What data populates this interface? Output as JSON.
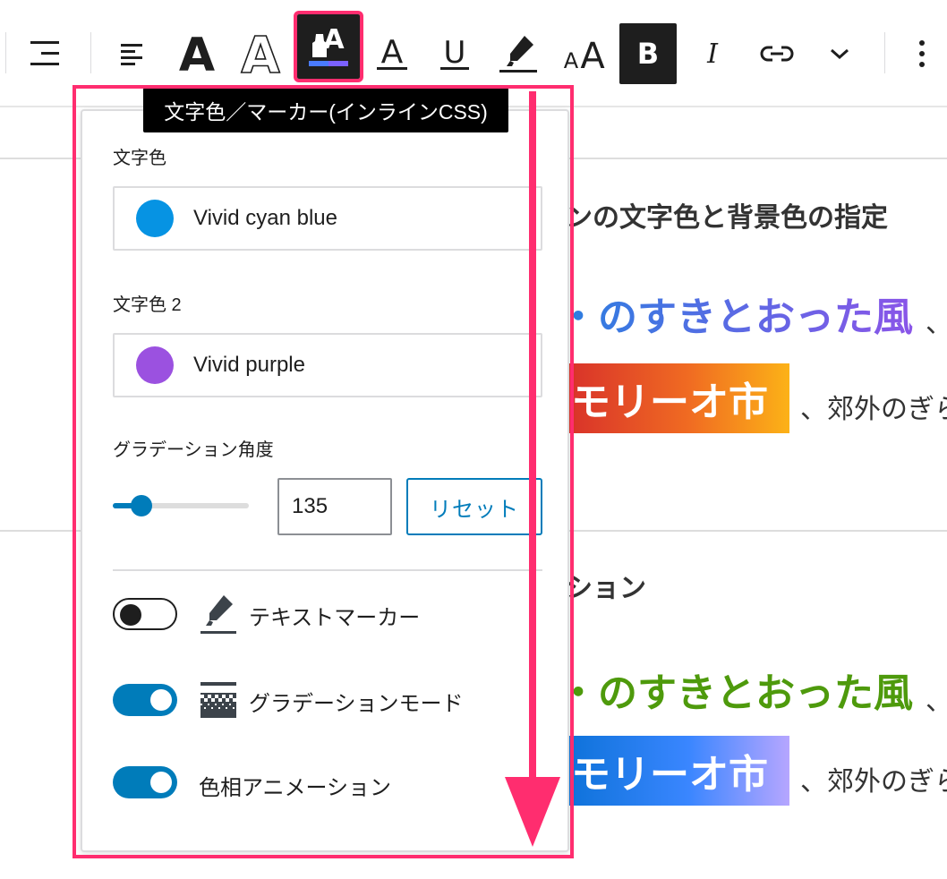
{
  "toolbar": {
    "buttons": [
      {
        "name": "align-icon",
        "interactable": true
      },
      {
        "name": "align-left-icon",
        "interactable": true
      },
      {
        "name": "bold-letter-a-icon",
        "interactable": true
      },
      {
        "name": "outline-letter-a-icon",
        "interactable": true
      },
      {
        "name": "text-color-marker-icon",
        "interactable": true,
        "highlighted": true
      },
      {
        "name": "underline-a-icon",
        "interactable": true
      },
      {
        "name": "underline-u-icon",
        "interactable": true
      },
      {
        "name": "highlighter-pen-icon",
        "interactable": true
      },
      {
        "name": "font-size-icon",
        "interactable": true
      },
      {
        "name": "bold-icon",
        "interactable": true,
        "label": "B"
      },
      {
        "name": "italic-icon",
        "interactable": true,
        "label": "I"
      },
      {
        "name": "link-icon",
        "interactable": true
      },
      {
        "name": "chevron-down-icon",
        "interactable": true
      },
      {
        "name": "more-options-icon",
        "interactable": true
      }
    ],
    "bold_label": "B",
    "italic_label": "I"
  },
  "tooltip": {
    "text": "文字色／マーカー(インラインCSS)"
  },
  "popover": {
    "text_color_label": "文字色",
    "text_color_value": "Vivid cyan blue",
    "text_color_hex": "#0693e3",
    "text_color2_label": "文字色 2",
    "text_color2_value": "Vivid purple",
    "text_color2_hex": "#9b51e0",
    "gradient_angle_label": "グラデーション角度",
    "gradient_angle_value": "135",
    "gradient_angle_slider_fraction": 0.21,
    "reset_label": "リセット",
    "options": [
      {
        "label": "テキストマーカー",
        "enabled": false,
        "icon": "marker-pen-icon"
      },
      {
        "label": "グラデーションモード",
        "enabled": true,
        "icon": "gradient-pattern-icon"
      },
      {
        "label": "色相アニメーション",
        "enabled": true,
        "icon": ""
      }
    ]
  },
  "editor": {
    "heading1_partial": "ンの文字色と背景色の指定",
    "line1_partial": "のすきとおった風",
    "line1_tail": "、",
    "marker1_text": "モリーオ市",
    "marker1_tail": "、郊外のぎら",
    "heading2_partial": "ション",
    "line2_partial": "のすきとおった風",
    "line2_tail": "、",
    "marker2_text": "モリーオ市",
    "marker2_tail": "、郊外のぎら"
  },
  "colors": {
    "accent_blue": "#007cba",
    "highlight_pink": "#ff2d6f",
    "green_text": "#4e9a0c"
  }
}
